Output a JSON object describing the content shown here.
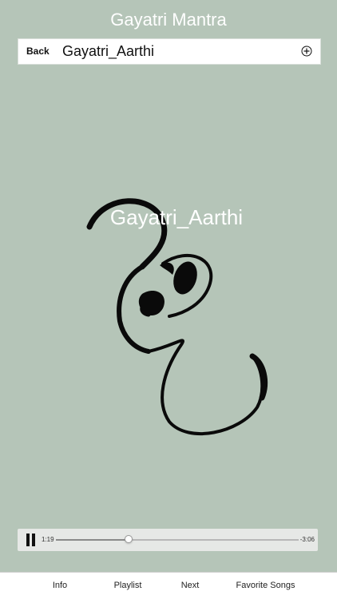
{
  "app": {
    "title": "Gayatri Mantra"
  },
  "header": {
    "back_label": "Back",
    "track_title": "Gayatri_Aarthi"
  },
  "artwork": {
    "overlay_title": "Gayatri_Aarthi",
    "icon": "om-symbol-icon"
  },
  "player": {
    "elapsed": "1:19",
    "remaining": "-3:06",
    "progress": 0.3,
    "state": "playing"
  },
  "tabs": [
    {
      "label": "Info"
    },
    {
      "label": "Playlist"
    },
    {
      "label": "Next"
    },
    {
      "label": "Favorite Songs"
    }
  ],
  "colors": {
    "background": "#b5c5b8",
    "bar": "#ffffff",
    "text": "#111111"
  }
}
